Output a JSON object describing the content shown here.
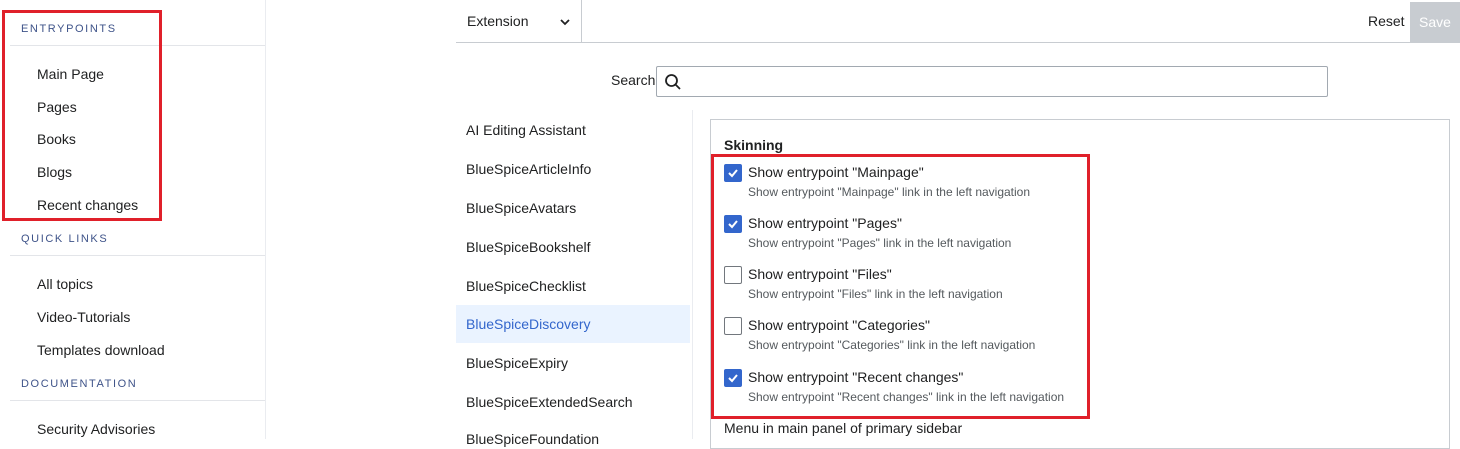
{
  "sidebar": {
    "sections": [
      {
        "title": "ENTRYPOINTS",
        "items": [
          "Main Page",
          "Pages",
          "Books",
          "Blogs",
          "Recent changes"
        ]
      },
      {
        "title": "QUICK LINKS",
        "items": [
          "All topics",
          "Video-Tutorials",
          "Templates download"
        ]
      },
      {
        "title": "DOCUMENTATION",
        "items": [
          "Security Advisories"
        ]
      }
    ]
  },
  "toolbar": {
    "select_value": "Extension",
    "reset_label": "Reset",
    "save_label": "Save"
  },
  "search": {
    "label": "Search",
    "value": ""
  },
  "extensions": {
    "items": [
      "AI Editing Assistant",
      "BlueSpiceArticleInfo",
      "BlueSpiceAvatars",
      "BlueSpiceBookshelf",
      "BlueSpiceChecklist",
      "BlueSpiceDiscovery",
      "BlueSpiceExpiry",
      "BlueSpiceExtendedSearch"
    ],
    "cut_off_item": "BlueSpiceFoundation",
    "active": "BlueSpiceDiscovery"
  },
  "panel": {
    "title": "Skinning",
    "options": [
      {
        "label": "Show entrypoint \"Mainpage\"",
        "description": "Show entrypoint \"Mainpage\" link in the left navigation",
        "checked": true
      },
      {
        "label": "Show entrypoint \"Pages\"",
        "description": "Show entrypoint \"Pages\" link in the left navigation",
        "checked": true
      },
      {
        "label": "Show entrypoint \"Files\"",
        "description": "Show entrypoint \"Files\" link in the left navigation",
        "checked": false
      },
      {
        "label": "Show entrypoint \"Categories\"",
        "description": "Show entrypoint \"Categories\" link in the left navigation",
        "checked": false
      },
      {
        "label": "Show entrypoint \"Recent changes\"",
        "description": "Show entrypoint \"Recent changes\" link in the left navigation",
        "checked": true
      }
    ],
    "footer_text": "Menu in main panel of primary sidebar"
  },
  "colors": {
    "accent": "#3366cc",
    "highlight": "#e0202a",
    "section_heading": "#3e5389",
    "active_bg": "#eaf3ff"
  },
  "icons": {
    "search": "search-icon",
    "dropdown": "chevron-down-icon",
    "check": "check-icon"
  }
}
